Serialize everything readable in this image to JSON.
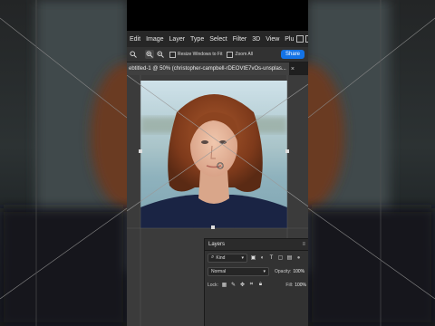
{
  "menubar": {
    "items": [
      "Edit",
      "Image",
      "Layer",
      "Type",
      "Select",
      "Filter",
      "3D",
      "View",
      "Plu"
    ]
  },
  "options_bar": {
    "resize_windows_label": "Resize Windows to Fit",
    "zoom_all_label": "Zoom All",
    "share_label": "Share",
    "icons": [
      "search-icon",
      "zoom-in-icon",
      "zoom-out-icon"
    ]
  },
  "document_tab": {
    "title": "ebtitled-1 @ 50% (christopher-campbell-rDEOVtE7vOs-unsplas...",
    "close_glyph": "×"
  },
  "layers_panel": {
    "title": "Layers",
    "menu_glyph": "≡",
    "filter_kind": "Kind",
    "blend_mode": "Normal",
    "opacity_label": "Opacity:",
    "opacity_value": "100%",
    "lock_label": "Lock:",
    "fill_label": "Fill:",
    "fill_value": "100%"
  },
  "colors": {
    "accent": "#1473e6",
    "panel_bg": "#323232",
    "menu_bg": "#262626"
  }
}
